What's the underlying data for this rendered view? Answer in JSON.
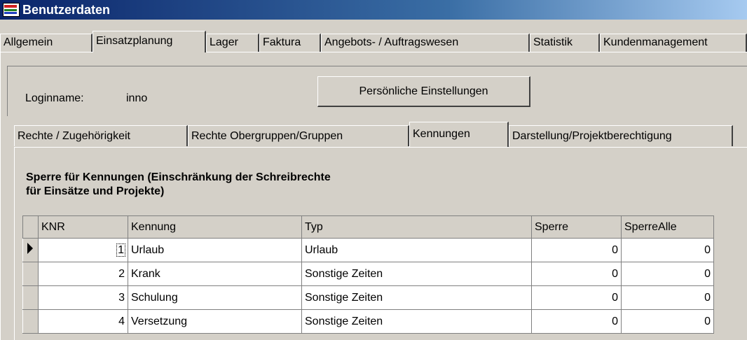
{
  "window": {
    "title": "Benutzerdaten"
  },
  "top_tabs": [
    {
      "label": "Allgemein"
    },
    {
      "label": "Einsatzplanung"
    },
    {
      "label": "Lager"
    },
    {
      "label": "Faktura"
    },
    {
      "label": "Angebots- / Auftragswesen"
    },
    {
      "label": "Statistik"
    },
    {
      "label": "Kundenmanagement"
    }
  ],
  "login": {
    "label": "Loginname:",
    "value": "inno",
    "settings_button": "Persönliche Einstellungen"
  },
  "inner_tabs": [
    {
      "label": "Rechte / Zugehörigkeit"
    },
    {
      "label": "Rechte Obergruppen/Gruppen"
    },
    {
      "label": "Kennungen"
    },
    {
      "label": "Darstellung/Projektberechtigung"
    }
  ],
  "section": {
    "title_line1": "Sperre für Kennungen (Einschränkung der Schreibrechte",
    "title_line2": "für Einsätze und Projekte)"
  },
  "grid": {
    "columns": [
      "KNR",
      "Kennung",
      "Typ",
      "Sperre",
      "SperreAlle"
    ],
    "rows": [
      [
        "1",
        "Urlaub",
        "Urlaub",
        "0",
        "0"
      ],
      [
        "2",
        "Krank",
        "Sonstige Zeiten",
        "0",
        "0"
      ],
      [
        "3",
        "Schulung",
        "Sonstige Zeiten",
        "0",
        "0"
      ],
      [
        "4",
        "Versetzung",
        "Sonstige Zeiten",
        "0",
        "0"
      ]
    ]
  }
}
